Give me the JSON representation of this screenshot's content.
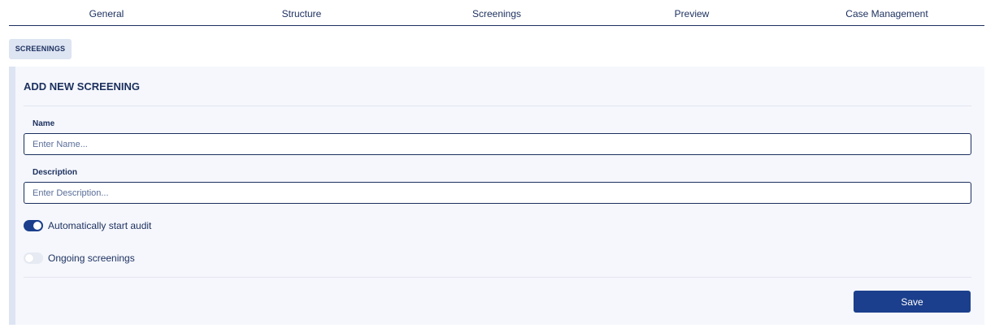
{
  "tabs": [
    {
      "label": "General"
    },
    {
      "label": "Structure"
    },
    {
      "label": "Screenings"
    },
    {
      "label": "Preview"
    },
    {
      "label": "Case Management"
    }
  ],
  "section_badge": "SCREENINGS",
  "card": {
    "title": "ADD NEW SCREENING",
    "name_field": {
      "label": "Name",
      "placeholder": "Enter Name...",
      "value": ""
    },
    "description_field": {
      "label": "Description",
      "placeholder": "Enter Description...",
      "value": ""
    },
    "toggles": [
      {
        "label": "Automatically start audit",
        "checked": true
      },
      {
        "label": "Ongoing screenings",
        "checked": false
      }
    ],
    "save_label": "Save"
  },
  "colors": {
    "primary": "#1b3f8c",
    "text": "#1b2f5e",
    "card_background": "#f5f7fc",
    "badge_background": "#dde4f2"
  }
}
